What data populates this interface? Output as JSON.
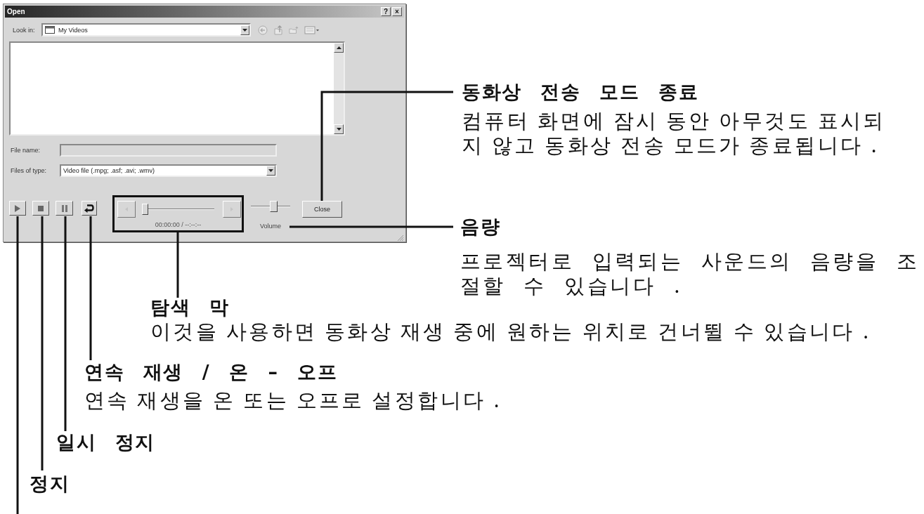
{
  "window": {
    "title": "Open",
    "title_buttons": [
      "?",
      "×"
    ]
  },
  "look_in": {
    "label": "Look in:",
    "value": "My Videos"
  },
  "file_name": {
    "label": "File name:",
    "disabled": true
  },
  "file_type": {
    "label": "Files of type:",
    "value": "Video file (.mpg; .asf; .avi; .wmv)"
  },
  "playback_buttons": [
    {
      "kind": "play"
    },
    {
      "kind": "stop"
    },
    {
      "kind": "pause"
    },
    {
      "kind": "loop"
    }
  ],
  "seek_bar": {
    "level": 0,
    "time": "00:00:00 / --:--:--"
  },
  "volume": {
    "label": "Volume",
    "level": 0.6
  },
  "close_button": {
    "label": "Close"
  },
  "callouts": [
    {
      "kind": "close",
      "title": "동화상 전송 모드 종료",
      "description": "컴퓨터 화면에 잠시 동안 아무것도 표시되지 않고 동화상 전송 모드가 종료됩니다 ."
    },
    {
      "kind": "volume",
      "title": "음량",
      "description": "프로젝터로 입력되는 사운드의 음량을 조절할 수 있습니다 ."
    },
    {
      "kind": "seek",
      "title": "탐색 막",
      "description": "이것을 사용하면 동화상 재생 중에 원하는 위치로 건너뛸 수 있습니다 ."
    },
    {
      "kind": "loop",
      "title": "연속 재생 / 온 – 오프",
      "description": "연속 재생을 온 또는 오프로 설정합니다 ."
    },
    {
      "kind": "pause",
      "title": "일시 정지"
    },
    {
      "kind": "stop",
      "title": "정지"
    },
    {
      "kind": "play"
    }
  ]
}
